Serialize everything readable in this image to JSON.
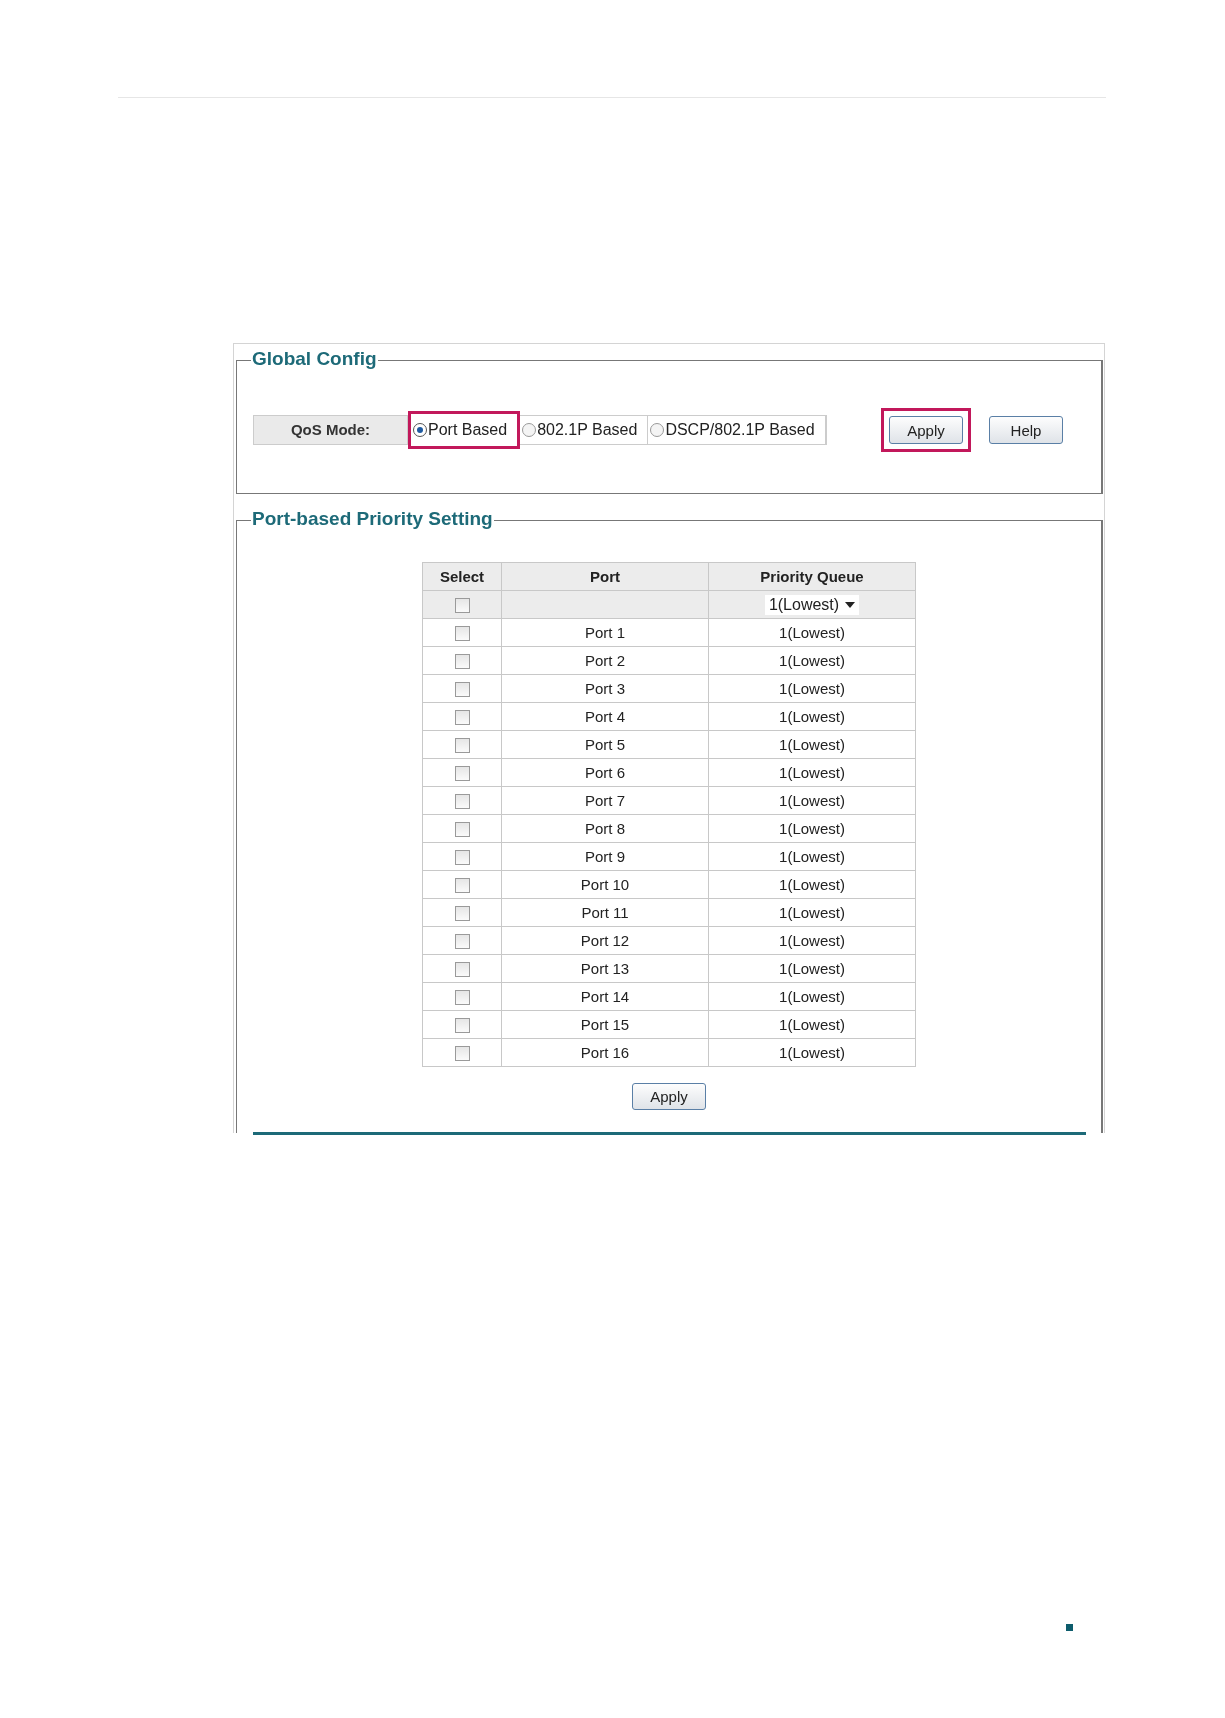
{
  "global_config": {
    "title": "Global Config",
    "qos_label": "QoS Mode:",
    "modes": [
      {
        "label": "Port Based",
        "selected": true,
        "highlighted": true
      },
      {
        "label": "802.1P Based",
        "selected": false,
        "highlighted": false
      },
      {
        "label": "DSCP/802.1P Based",
        "selected": false,
        "highlighted": false
      }
    ],
    "buttons": [
      {
        "label": "Apply",
        "highlighted": true
      },
      {
        "label": "Help",
        "highlighted": false
      }
    ]
  },
  "port_priority": {
    "title": "Port-based Priority Setting",
    "columns": [
      "Select",
      "Port",
      "Priority Queue"
    ],
    "all_row": {
      "checked": false,
      "queue": "1(Lowest)"
    },
    "rows": [
      {
        "checked": false,
        "port": "Port 1",
        "queue": "1(Lowest)"
      },
      {
        "checked": false,
        "port": "Port 2",
        "queue": "1(Lowest)"
      },
      {
        "checked": false,
        "port": "Port 3",
        "queue": "1(Lowest)"
      },
      {
        "checked": false,
        "port": "Port 4",
        "queue": "1(Lowest)"
      },
      {
        "checked": false,
        "port": "Port 5",
        "queue": "1(Lowest)"
      },
      {
        "checked": false,
        "port": "Port 6",
        "queue": "1(Lowest)"
      },
      {
        "checked": false,
        "port": "Port 7",
        "queue": "1(Lowest)"
      },
      {
        "checked": false,
        "port": "Port 8",
        "queue": "1(Lowest)"
      },
      {
        "checked": false,
        "port": "Port 9",
        "queue": "1(Lowest)"
      },
      {
        "checked": false,
        "port": "Port 10",
        "queue": "1(Lowest)"
      },
      {
        "checked": false,
        "port": "Port 11",
        "queue": "1(Lowest)"
      },
      {
        "checked": false,
        "port": "Port 12",
        "queue": "1(Lowest)"
      },
      {
        "checked": false,
        "port": "Port 13",
        "queue": "1(Lowest)"
      },
      {
        "checked": false,
        "port": "Port 14",
        "queue": "1(Lowest)"
      },
      {
        "checked": false,
        "port": "Port 15",
        "queue": "1(Lowest)"
      },
      {
        "checked": false,
        "port": "Port 16",
        "queue": "1(Lowest)"
      }
    ],
    "apply_button": "Apply"
  }
}
